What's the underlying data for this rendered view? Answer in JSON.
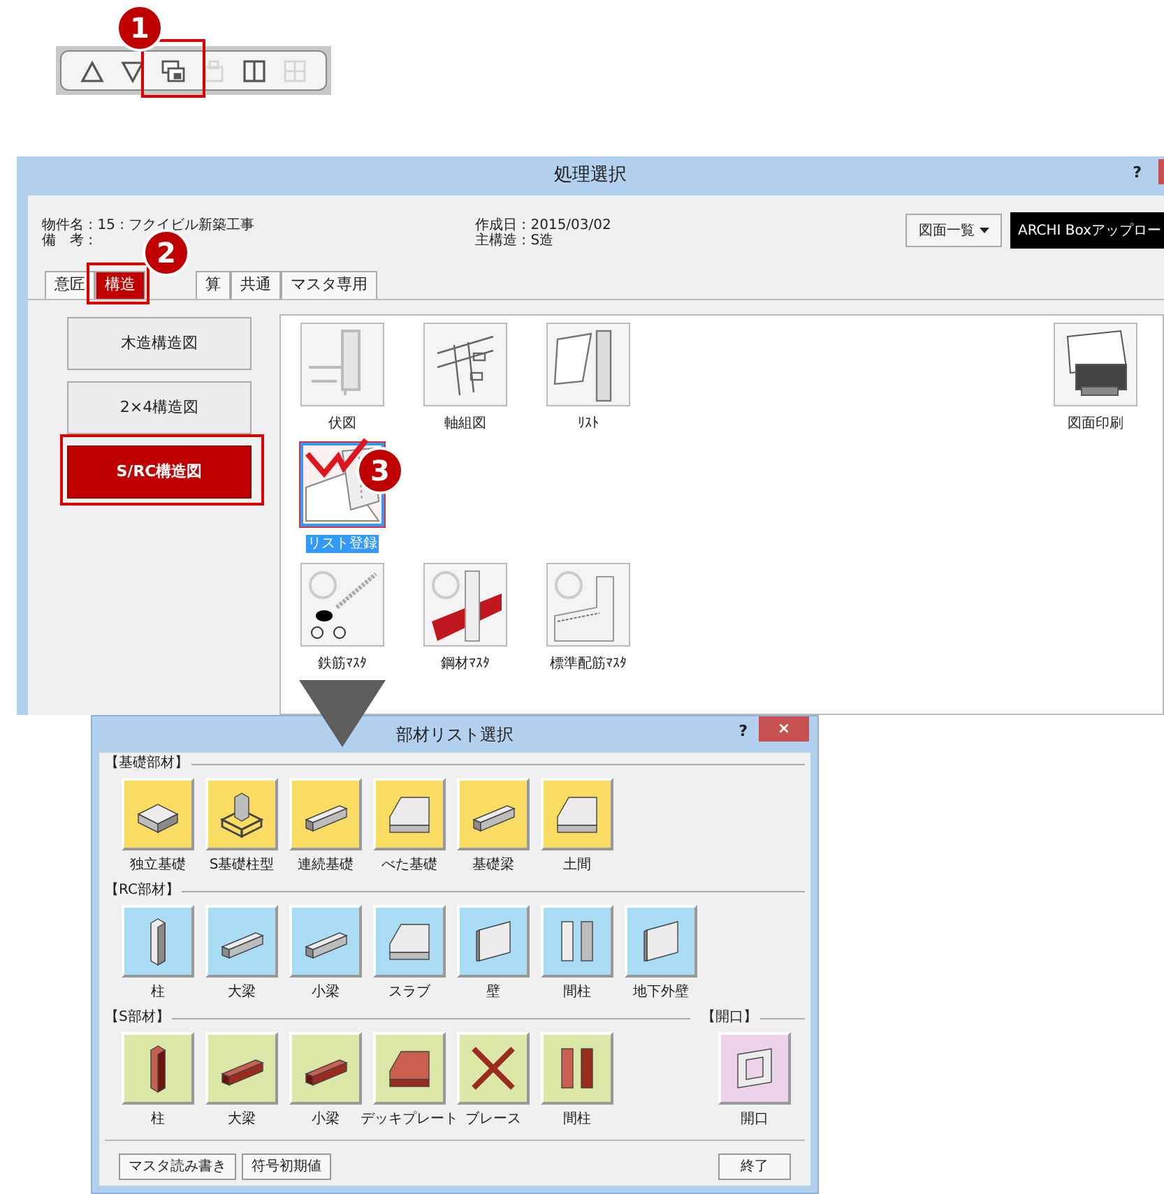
{
  "toolbar": {
    "buttons": [
      {
        "kind": "up",
        "disabled": false
      },
      {
        "kind": "down",
        "disabled": false
      },
      {
        "kind": "window",
        "disabled": false
      },
      {
        "kind": "paste",
        "disabled": true
      },
      {
        "kind": "split",
        "disabled": false
      },
      {
        "kind": "grid",
        "disabled": true
      }
    ]
  },
  "main_window": {
    "title": "処理選択",
    "help": "?",
    "info": [
      [
        "物件名 : 15 : フクイビル新築工事",
        "備　考 :"
      ],
      [
        "作成日 : 2015/03/02",
        "主構造 : S造"
      ]
    ],
    "list_button": "図面一覧",
    "upload_button": "ARCHI Boxアップロー",
    "tabs": [
      {
        "label": "意匠",
        "selected": false
      },
      {
        "label": "構造",
        "selected": true
      },
      {
        "label": "算",
        "selected": false
      },
      {
        "label": "共通",
        "selected": false
      },
      {
        "label": "マスタ専用",
        "selected": false
      }
    ],
    "categories": [
      {
        "label": "木造構造図",
        "selected": false
      },
      {
        "label": "2×4構造図",
        "selected": false
      },
      {
        "label": "S/RC構造図",
        "selected": true
      }
    ],
    "tool_rows": [
      [
        {
          "label": "伏図",
          "kind": "plan",
          "selected": false
        },
        {
          "label": "軸組図",
          "kind": "framing",
          "selected": false
        },
        {
          "label": "ﾘｽﾄ",
          "kind": "list",
          "selected": false
        },
        {
          "label": "図面印刷",
          "kind": "print",
          "selected": false
        }
      ],
      [
        {
          "label": "リスト登録",
          "kind": "register",
          "selected": true
        }
      ],
      [
        {
          "label": "鉄筋ﾏｽﾀ",
          "kind": "rebar",
          "selected": false
        },
        {
          "label": "鋼材ﾏｽﾀ",
          "kind": "steel",
          "selected": false
        },
        {
          "label": "標準配筋ﾏｽﾀ",
          "kind": "standard",
          "selected": false
        }
      ]
    ]
  },
  "dialog": {
    "title": "部材リスト選択",
    "help": "?",
    "close": "×",
    "groups": [
      {
        "label": "【基礎部材】",
        "color": "#fbdc63",
        "kind": "concrete",
        "items": [
          {
            "label": "独立基礎",
            "kind": "block"
          },
          {
            "label": "S基礎柱型",
            "kind": "pedestal"
          },
          {
            "label": "連続基礎",
            "kind": "beam"
          },
          {
            "label": "べた基礎",
            "kind": "slab"
          },
          {
            "label": "基礎梁",
            "kind": "beam"
          },
          {
            "label": "土間",
            "kind": "slab"
          }
        ]
      },
      {
        "label": "【RC部材】",
        "color": "#aadcf6",
        "kind": "concrete",
        "items": [
          {
            "label": "柱",
            "kind": "column"
          },
          {
            "label": "大梁",
            "kind": "beam"
          },
          {
            "label": "小梁",
            "kind": "beam"
          },
          {
            "label": "スラブ",
            "kind": "slab"
          },
          {
            "label": "壁",
            "kind": "wall"
          },
          {
            "label": "間柱",
            "kind": "pair"
          },
          {
            "label": "地下外壁",
            "kind": "wall"
          }
        ]
      },
      {
        "label": "【S部材】",
        "color": "#dbe7a6",
        "kind": "steel",
        "items": [
          {
            "label": "柱",
            "kind": "column"
          },
          {
            "label": "大梁",
            "kind": "beam"
          },
          {
            "label": "小梁",
            "kind": "beam"
          },
          {
            "label": "デッキプレート",
            "kind": "slab"
          },
          {
            "label": "ブレース",
            "kind": "brace"
          },
          {
            "label": "間柱",
            "kind": "pair"
          }
        ]
      },
      {
        "label": "【開口】",
        "color": "#ecd2ea",
        "kind": "concrete",
        "items": [
          {
            "label": "開口",
            "kind": "frame"
          }
        ]
      }
    ],
    "buttons": [
      "マスタ読み書き",
      "符号初期値"
    ],
    "end_button": "終了"
  },
  "callouts": [
    "1",
    "2",
    "3"
  ]
}
